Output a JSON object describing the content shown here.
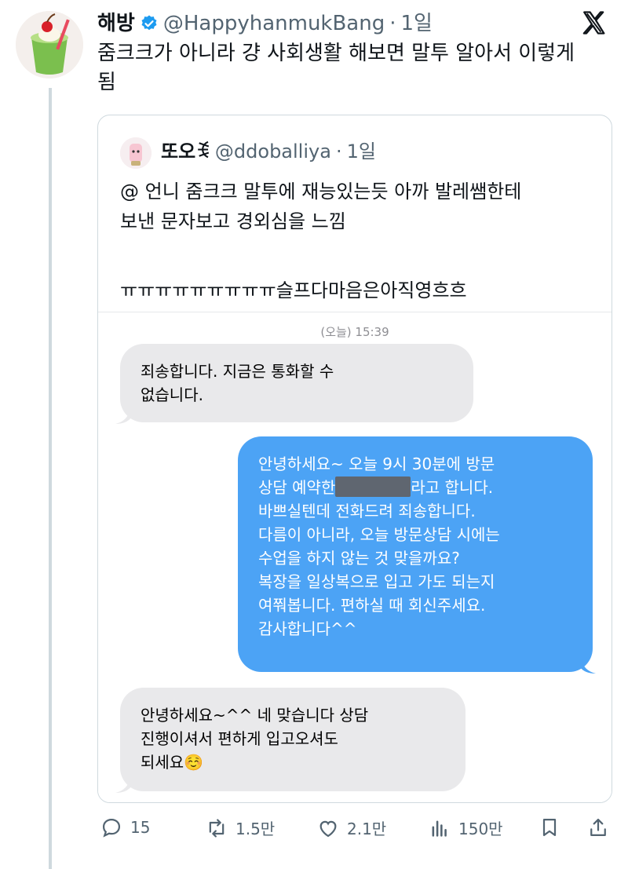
{
  "tweet": {
    "author_name": "해방",
    "handle": "@HappyhanmukBang",
    "separator": "·",
    "time": "1일",
    "text": "줌크크가 아니라 걍 사회생활 해보면 말투 알아서 이렇게 됨"
  },
  "quote": {
    "author_name": "또오ꉂ",
    "handle": "@ddoballiya",
    "separator": "·",
    "time": "1일",
    "line1": "@ 언니 줌크크 말투에 재능있는듯 아까 발레쌤한테",
    "line2": "보낸 문자보고 경외심을 느낌",
    "line3": "ㅠㅠㅠㅠㅠㅠㅠㅠㅠ슬프다마음은아직영흐흐"
  },
  "chat": {
    "timestamp": "(오늘) 15:39",
    "msg1_line1": "죄송합니다. 지금은 통화할 수",
    "msg1_line2": "없습니다.",
    "msg2_line1": "안녕하세요~ 오늘 9시 30분에 방문",
    "msg2_line2a": "상담 예약한",
    "msg2_line2b": "라고 합니다.",
    "msg2_line3": "바쁘실텐데 전화드려 죄송합니다.",
    "msg2_line4": "다름이 아니라, 오늘 방문상담 시에는",
    "msg2_line5": "수업을 하지 않는 것 맞을까요?",
    "msg2_line6": "복장을 일상복으로 입고 가도 되는지",
    "msg2_line7": "여쭤봅니다. 편하실 때 회신주세요.",
    "msg2_line8": "감사합니다^^",
    "msg3_line1": "안녕하세요~^^ 네 맞습니다 상담",
    "msg3_line2": "진행이셔서 편하게 입고오셔도",
    "msg3_line3": "되세요☺️"
  },
  "actions": {
    "replies": "15",
    "retweets": "1.5만",
    "likes": "2.1만",
    "views": "150만"
  },
  "colors": {
    "accent": "#1d9bf0",
    "imessage_blue": "#4ca3f5",
    "gray_bubble": "#e9e9eb"
  }
}
